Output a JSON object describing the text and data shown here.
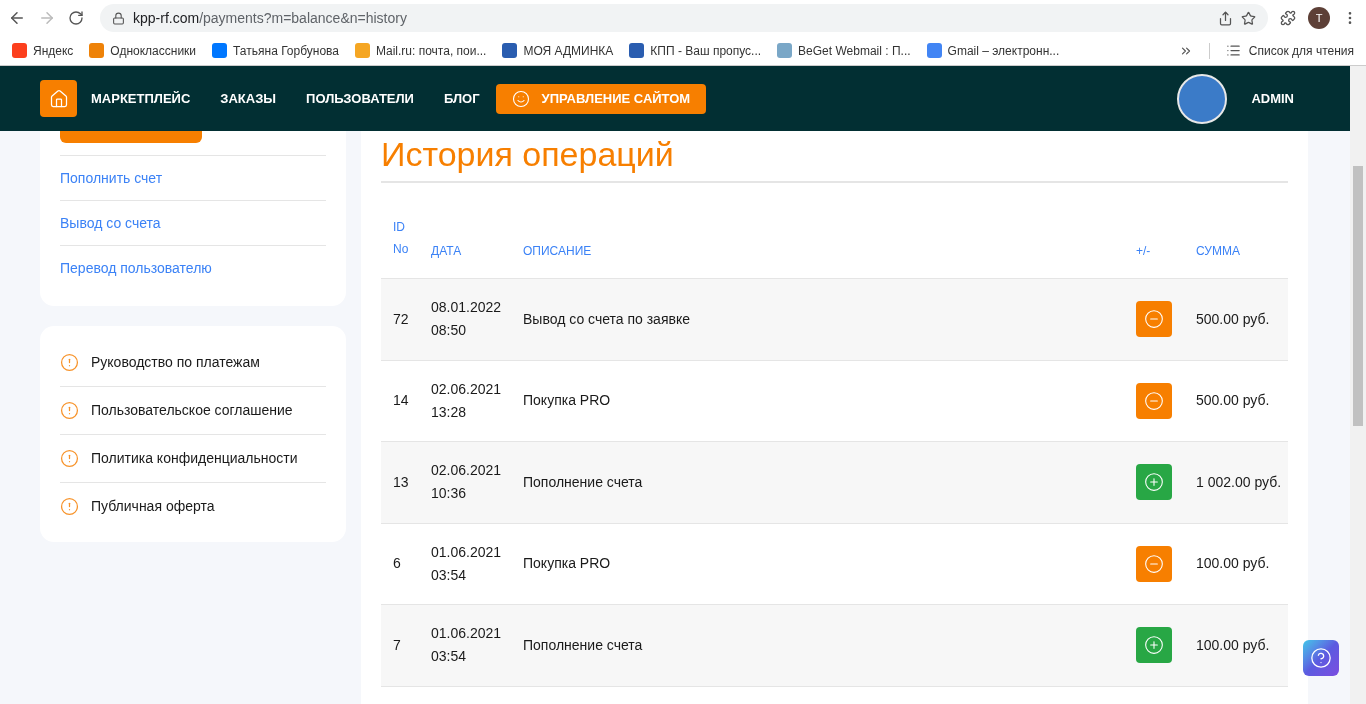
{
  "browser": {
    "url_host": "kpp-rf.com",
    "url_path": "/payments?m=balance&n=history",
    "profile_initial": "T",
    "bookmarks": [
      {
        "label": "Яндекс",
        "color": "#fc3f1d"
      },
      {
        "label": "Одноклассники",
        "color": "#ee8208"
      },
      {
        "label": "Татьяна Горбунова",
        "color": "#0077ff"
      },
      {
        "label": "Mail.ru: почта, пои...",
        "color": "#f5a623"
      },
      {
        "label": "МОЯ АДМИНКА",
        "color": "#2a5db0"
      },
      {
        "label": "КПП - Ваш пропус...",
        "color": "#2a5db0"
      },
      {
        "label": "BeGet Webmail : П...",
        "color": "#7aa7c7"
      },
      {
        "label": "Gmail – электронн...",
        "color": "#4285f4"
      }
    ],
    "reading_list": "Список для чтения"
  },
  "nav": {
    "items": [
      "МАРКЕТПЛЕЙС",
      "ЗАКАЗЫ",
      "ПОЛЬЗОВАТЕЛИ",
      "БЛОГ"
    ],
    "manage_button": "УПРАВЛЕНИЕ САЙТОМ",
    "user": "ADMIN"
  },
  "sidebar": {
    "links": [
      "Пополнить счет",
      "Вывод со счета",
      "Перевод пользователю"
    ],
    "docs": [
      "Руководство по платежам",
      "Пользовательское соглашение",
      "Политика конфиденциальности",
      "Публичная оферта"
    ]
  },
  "main": {
    "title": "История операций",
    "columns": {
      "id": [
        "ID",
        "No"
      ],
      "date": "ДАТА",
      "description": "ОПИСАНИЕ",
      "sign": "+/-",
      "amount": "СУММА"
    },
    "rows": [
      {
        "id": "72",
        "date": "08.01.2022",
        "time": "08:50",
        "description": "Вывод со счета по заявке",
        "kind": "minus",
        "amount": "500.00 руб."
      },
      {
        "id": "14",
        "date": "02.06.2021",
        "time": "13:28",
        "description": "Покупка PRO",
        "kind": "minus",
        "amount": "500.00 руб."
      },
      {
        "id": "13",
        "date": "02.06.2021",
        "time": "10:36",
        "description": "Пополнение счета",
        "kind": "plus",
        "amount": "1 002.00 руб."
      },
      {
        "id": "6",
        "date": "01.06.2021",
        "time": "03:54",
        "description": "Покупка PRO",
        "kind": "minus",
        "amount": "100.00 руб."
      },
      {
        "id": "7",
        "date": "01.06.2021",
        "time": "03:54",
        "description": "Пополнение счета",
        "kind": "plus",
        "amount": "100.00 руб."
      }
    ]
  }
}
